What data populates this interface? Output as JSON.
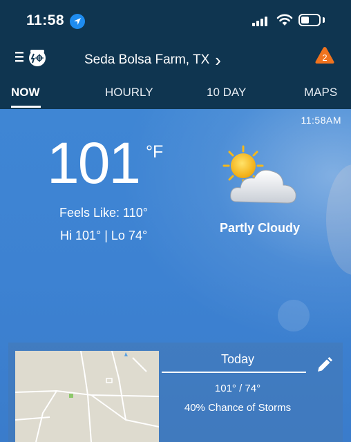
{
  "status_bar": {
    "time": "11:58",
    "battery_level": 0.45
  },
  "header": {
    "location": "Seda Bolsa Farm, TX",
    "location_chevron": "›",
    "alert_count": "2",
    "alert_color": "#f0731e"
  },
  "tabs": [
    {
      "label": "NOW",
      "active": true
    },
    {
      "label": "HOURLY",
      "active": false
    },
    {
      "label": "10 DAY",
      "active": false
    },
    {
      "label": "MAPS",
      "active": false
    }
  ],
  "current": {
    "updated_time": "11:58AM",
    "temperature": "101",
    "unit": "°F",
    "feels_like": "Feels Like: 110°",
    "hi_lo": "Hi 101° | Lo 74°",
    "condition": "Partly Cloudy",
    "condition_icon": "partly-cloudy-icon"
  },
  "forecast_card": {
    "day": "Today",
    "temps": "101° / 74°",
    "storm": "40% Chance of Storms"
  },
  "colors": {
    "header_bg": "#0f3550",
    "sky": "#3d82d2",
    "accent_blue": "#1e8cf0"
  }
}
